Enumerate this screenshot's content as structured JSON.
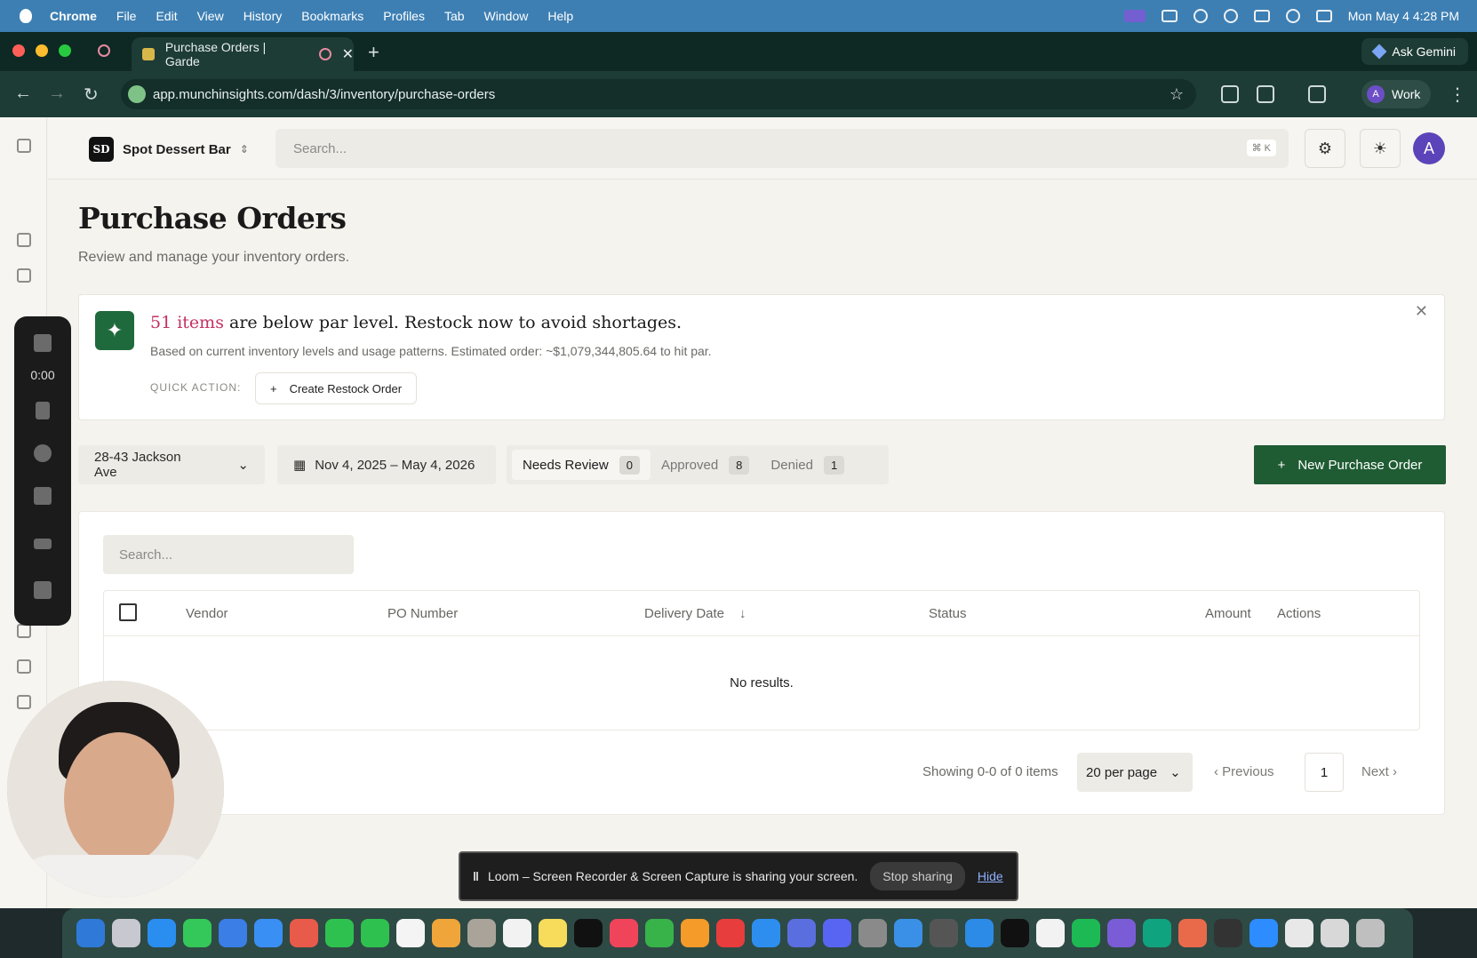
{
  "menubar": {
    "app": "Chrome",
    "items": [
      "File",
      "Edit",
      "View",
      "History",
      "Bookmarks",
      "Profiles",
      "Tab",
      "Window",
      "Help"
    ],
    "clock": "Mon May 4  4:28 PM"
  },
  "browser": {
    "tab_title": "Purchase Orders | Garde",
    "url": "app.munchinsights.com/dash/3/inventory/purchase-orders",
    "gemini_label": "Ask Gemini",
    "profile_label": "Work",
    "profile_initial": "A"
  },
  "header": {
    "org_initials": "SD",
    "org_name": "Spot Dessert Bar",
    "search_placeholder": "Search...",
    "search_shortcut": "⌘ K",
    "avatar_initial": "A"
  },
  "page": {
    "title": "Purchase Orders",
    "subtitle": "Review and manage your inventory orders."
  },
  "alert": {
    "highlight": "51 items",
    "headline_rest": " are below par level. Restock now to avoid shortages.",
    "description": "Based on current inventory levels and usage patterns. Estimated order: ~$1,079,344,805.64 to hit par.",
    "quick_action_label": "QUICK ACTION:",
    "restock_button": "Create Restock Order"
  },
  "filters": {
    "location": "28-43 Jackson Ave",
    "date_range": "Nov 4, 2025 – May 4, 2026",
    "status_tabs": [
      {
        "label": "Needs Review",
        "count": "0"
      },
      {
        "label": "Approved",
        "count": "8"
      },
      {
        "label": "Denied",
        "count": "1"
      }
    ],
    "new_po_button": "New Purchase Order"
  },
  "table": {
    "search_placeholder": "Search...",
    "columns": [
      "Vendor",
      "PO Number",
      "Delivery Date",
      "Status",
      "Amount",
      "Actions"
    ],
    "sort_indicator": "↓",
    "empty_text": "No results."
  },
  "pagination": {
    "summary": "Showing 0-0 of 0 items",
    "per_page": "20 per page",
    "previous": "Previous",
    "page": "1",
    "next": "Next"
  },
  "loom": {
    "timer": "0:00",
    "share_message": "Loom – Screen Recorder & Screen Capture is sharing your screen.",
    "stop_button": "Stop sharing",
    "hide_link": "Hide"
  },
  "colors": {
    "brand_green": "#1f5c34",
    "highlight_pink": "#c43163",
    "menubar_blue": "#3d7fb3"
  }
}
